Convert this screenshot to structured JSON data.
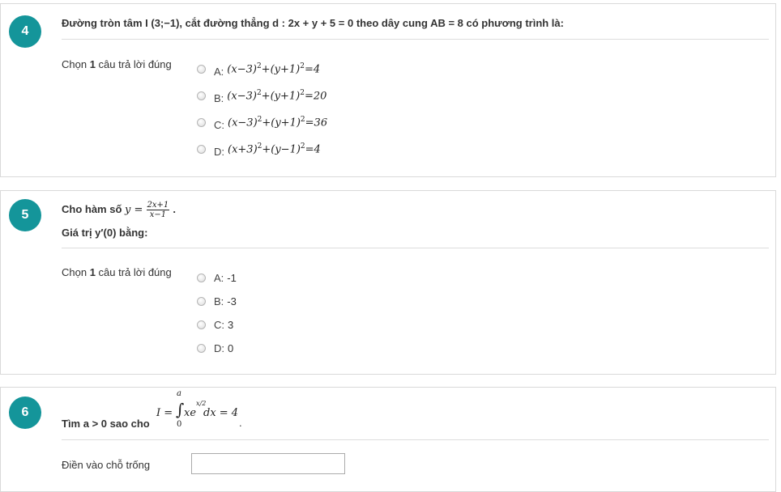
{
  "q4": {
    "number": "4",
    "text": "Đường tròn tâm I (3;−1), cắt đường thẳng d : 2x + y + 5 = 0 theo dây cung AB = 8 có phương trình là:",
    "prompt_prefix": "Chọn ",
    "prompt_bold": "1",
    "prompt_suffix": " câu trả lời đúng",
    "options": [
      {
        "letter": "A:",
        "math": "(x−3)",
        "math2": "+(y+1)",
        "rhs": "=4"
      },
      {
        "letter": "B:",
        "math": "(x−3)",
        "math2": "+(y+1)",
        "rhs": "=20"
      },
      {
        "letter": "C:",
        "math": "(x−3)",
        "math2": "+(y+1)",
        "rhs": "=36"
      },
      {
        "letter": "D:",
        "math": "(x+3)",
        "math2": "+(y−1)",
        "rhs": "=4"
      }
    ],
    "exp": "2"
  },
  "q5": {
    "number": "5",
    "line1_prefix": "Cho hàm số ",
    "y_eq": "y =",
    "frac_num": "2x+1",
    "frac_den": "x−1",
    "line1_suffix": " .",
    "line2": "Giá trị y′(0) bằng:",
    "prompt_prefix": "Chọn ",
    "prompt_bold": "1",
    "prompt_suffix": " câu trả lời đúng",
    "options": [
      {
        "letter": "A:",
        "value": "-1"
      },
      {
        "letter": "B:",
        "value": "-3"
      },
      {
        "letter": "C:",
        "value": "3"
      },
      {
        "letter": "D:",
        "value": "0"
      }
    ]
  },
  "q6": {
    "number": "6",
    "text_prefix": "Tìm a > 0 sao cho",
    "integral_lhs": "I =",
    "upper": "a",
    "lower": "0",
    "integrand": "xe",
    "exp": "x/2",
    "rest": "dx = 4",
    "period": ".",
    "fill_label": "Điền vào chỗ trống",
    "fill_value": ""
  }
}
